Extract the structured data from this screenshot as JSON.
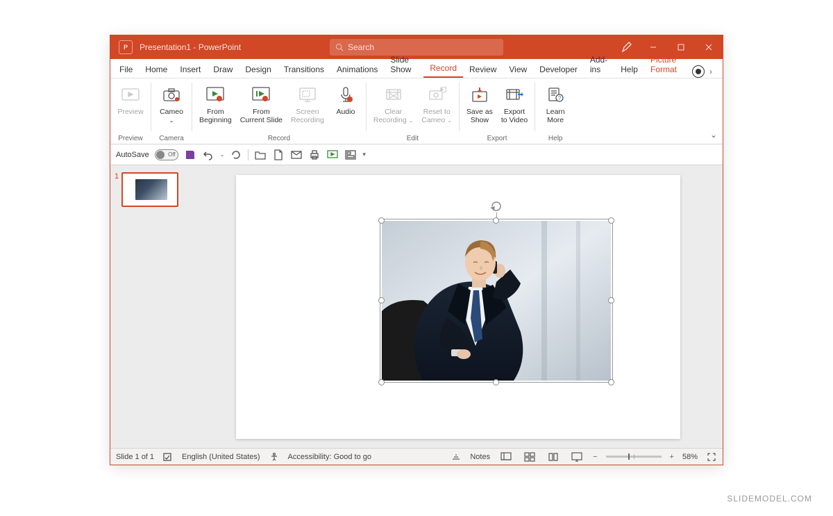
{
  "window": {
    "app_icon": "P",
    "title": "Presentation1 - PowerPoint",
    "search_placeholder": "Search"
  },
  "tabs": {
    "file": "File",
    "items": [
      "Home",
      "Insert",
      "Draw",
      "Design",
      "Transitions",
      "Animations",
      "Slide Show",
      "Record",
      "Review",
      "View",
      "Developer",
      "Add-ins",
      "Help"
    ],
    "active": "Record",
    "contextual": "Picture Format"
  },
  "ribbon": {
    "groups": [
      {
        "label": "Preview",
        "buttons": [
          {
            "label": "Preview",
            "disabled": true
          }
        ]
      },
      {
        "label": "Camera",
        "buttons": [
          {
            "label": "Cameo",
            "dropdown": true
          }
        ]
      },
      {
        "label": "Record",
        "buttons": [
          {
            "label": "From\nBeginning"
          },
          {
            "label": "From\nCurrent Slide"
          },
          {
            "label": "Screen\nRecording",
            "disabled": true
          },
          {
            "label": "Audio"
          }
        ]
      },
      {
        "label": "Edit",
        "buttons": [
          {
            "label": "Clear\nRecording",
            "dropdown": true,
            "disabled": true
          },
          {
            "label": "Reset to\nCameo",
            "dropdown": true,
            "disabled": true
          }
        ]
      },
      {
        "label": "Export",
        "buttons": [
          {
            "label": "Save as\nShow"
          },
          {
            "label": "Export\nto Video"
          }
        ]
      },
      {
        "label": "Help",
        "buttons": [
          {
            "label": "Learn\nMore"
          }
        ]
      }
    ]
  },
  "qat": {
    "autosave_label": "AutoSave",
    "autosave_state": "Off"
  },
  "thumbnail_number": "1",
  "status": {
    "slide_info": "Slide 1 of 1",
    "language": "English (United States)",
    "accessibility": "Accessibility: Good to go",
    "notes": "Notes",
    "zoom": "58%"
  },
  "watermark": "SLIDEMODEL.COM"
}
